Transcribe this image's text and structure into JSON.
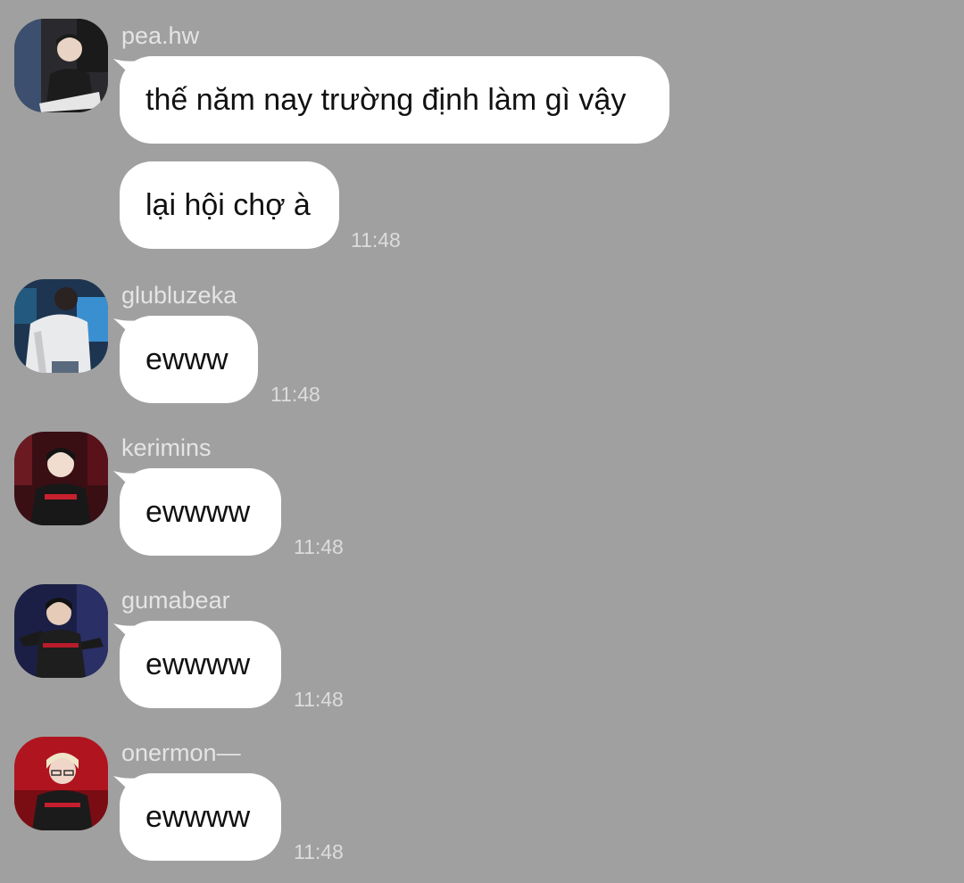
{
  "messages": [
    {
      "sender": "pea.hw",
      "avatar": "avatar-pea-hw",
      "bubbles": [
        "thế năm nay trường định làm gì vậy",
        "lại hội chợ à"
      ],
      "time": "11:48"
    },
    {
      "sender": "glubluzeka",
      "avatar": "avatar-glubluzeka",
      "bubbles": [
        "ewww"
      ],
      "time": "11:48"
    },
    {
      "sender": "kerimins",
      "avatar": "avatar-kerimins",
      "bubbles": [
        "ewwww"
      ],
      "time": "11:48"
    },
    {
      "sender": "gumabear",
      "avatar": "avatar-gumabear",
      "bubbles": [
        "ewwww"
      ],
      "time": "11:48"
    },
    {
      "sender": "onermon—",
      "avatar": "avatar-onermon",
      "bubbles": [
        "ewwww"
      ],
      "time": "11:48"
    }
  ],
  "colors": {
    "background": "#a0a0a0",
    "bubble": "#ffffff",
    "sender_text": "#e4e4e4",
    "time_text": "#dcdcdc"
  }
}
